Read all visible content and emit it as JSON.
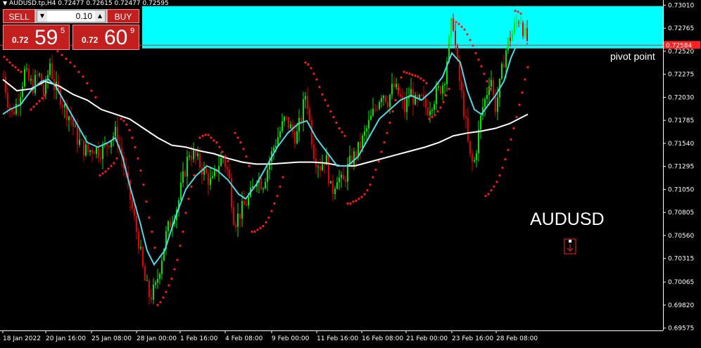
{
  "chart_title": "AUDUSD.tp,H4  0.72477 0.72615 0.72477 0.72595",
  "trade_panel": {
    "sell_label": "SELL",
    "buy_label": "BUY",
    "lot": "0.10",
    "sell_prefix": "0.72",
    "sell_big": "59",
    "sell_sup": "5",
    "buy_prefix": "0.72",
    "buy_big": "60",
    "buy_sup": "9"
  },
  "pivot_text": "pivot point",
  "symbol_text": "AUDUSD",
  "current_price_label": "0.72584",
  "colors": {
    "bull": "#00e600",
    "bear": "#e00000",
    "ma_fast": "#4fd8ea",
    "ma_slow": "#ffffff",
    "sar": "#ff1a1a",
    "zone": "#00ffff",
    "price_line": "#ff2020"
  },
  "chart_data": {
    "type": "candlestick",
    "title": "AUDUSD.tp,H4",
    "y_ticks": [
      "0.73010",
      "0.72765",
      "0.72520",
      "0.72275",
      "0.72030",
      "0.71785",
      "0.71540",
      "0.71295",
      "0.71050",
      "0.70805",
      "0.70560",
      "0.70315",
      "0.70065",
      "0.69820",
      "0.69575"
    ],
    "ylim": [
      0.6955,
      0.7305
    ],
    "x_ticks": [
      "18 Jan 2022",
      "20 Jan 16:00",
      "25 Jan 08:00",
      "28 Jan 00:00",
      "1 Feb 16:00",
      "4 Feb 08:00",
      "9 Feb 00:00",
      "11 Feb 16:00",
      "16 Feb 08:00",
      "21 Feb 00:00",
      "23 Feb 16:00",
      "28 Feb 08:00"
    ],
    "resistance_zone": [
      0.7255,
      0.73
    ],
    "pivot_level": 0.72584,
    "close_path": [
      [
        0,
        0.7225
      ],
      [
        6,
        0.72
      ],
      [
        12,
        0.7185
      ],
      [
        18,
        0.7195
      ],
      [
        24,
        0.721
      ],
      [
        30,
        0.723
      ],
      [
        36,
        0.722
      ],
      [
        42,
        0.7215
      ],
      [
        50,
        0.7228
      ],
      [
        58,
        0.7205
      ],
      [
        66,
        0.724
      ],
      [
        72,
        0.7215
      ],
      [
        80,
        0.7205
      ],
      [
        88,
        0.719
      ],
      [
        96,
        0.718
      ],
      [
        104,
        0.716
      ],
      [
        112,
        0.715
      ],
      [
        120,
        0.7145
      ],
      [
        128,
        0.715
      ],
      [
        136,
        0.7145
      ],
      [
        144,
        0.715
      ],
      [
        152,
        0.716
      ],
      [
        160,
        0.7165
      ],
      [
        168,
        0.714
      ],
      [
        176,
        0.711
      ],
      [
        184,
        0.708
      ],
      [
        192,
        0.705
      ],
      [
        200,
        0.701
      ],
      [
        208,
        0.699
      ],
      [
        216,
        0.7
      ],
      [
        224,
        0.703
      ],
      [
        232,
        0.706
      ],
      [
        240,
        0.7075
      ],
      [
        248,
        0.709
      ],
      [
        256,
        0.712
      ],
      [
        264,
        0.7145
      ],
      [
        272,
        0.714
      ],
      [
        280,
        0.713
      ],
      [
        288,
        0.712
      ],
      [
        296,
        0.711
      ],
      [
        304,
        0.713
      ],
      [
        312,
        0.714
      ],
      [
        320,
        0.712
      ],
      [
        328,
        0.707
      ],
      [
        336,
        0.708
      ],
      [
        344,
        0.709
      ],
      [
        352,
        0.71
      ],
      [
        360,
        0.712
      ],
      [
        368,
        0.711
      ],
      [
        376,
        0.713
      ],
      [
        384,
        0.715
      ],
      [
        392,
        0.7165
      ],
      [
        400,
        0.718
      ],
      [
        408,
        0.717
      ],
      [
        416,
        0.716
      ],
      [
        424,
        0.7185
      ],
      [
        430,
        0.721
      ],
      [
        436,
        0.717
      ],
      [
        442,
        0.714
      ],
      [
        450,
        0.713
      ],
      [
        458,
        0.714
      ],
      [
        466,
        0.71
      ],
      [
        474,
        0.712
      ],
      [
        482,
        0.711
      ],
      [
        490,
        0.713
      ],
      [
        498,
        0.714
      ],
      [
        506,
        0.715
      ],
      [
        514,
        0.7165
      ],
      [
        522,
        0.718
      ],
      [
        530,
        0.7195
      ],
      [
        538,
        0.721
      ],
      [
        546,
        0.72
      ],
      [
        554,
        0.7215
      ],
      [
        562,
        0.7205
      ],
      [
        570,
        0.719
      ],
      [
        578,
        0.721
      ],
      [
        586,
        0.7195
      ],
      [
        594,
        0.72
      ],
      [
        602,
        0.719
      ],
      [
        610,
        0.72
      ],
      [
        618,
        0.721
      ],
      [
        626,
        0.722
      ],
      [
        632,
        0.7255
      ],
      [
        638,
        0.729
      ],
      [
        644,
        0.724
      ],
      [
        650,
        0.721
      ],
      [
        656,
        0.718
      ],
      [
        662,
        0.714
      ],
      [
        668,
        0.713
      ],
      [
        674,
        0.716
      ],
      [
        680,
        0.719
      ],
      [
        686,
        0.7205
      ],
      [
        692,
        0.723
      ],
      [
        698,
        0.719
      ],
      [
        704,
        0.721
      ],
      [
        710,
        0.724
      ],
      [
        716,
        0.726
      ],
      [
        722,
        0.727
      ],
      [
        728,
        0.728
      ],
      [
        734,
        0.729
      ],
      [
        740,
        0.727
      ],
      [
        746,
        0.7259
      ]
    ],
    "series": [
      {
        "name": "",
        "type": "line",
        "points": [
          [
            0,
            0.7222
          ],
          [
            20,
            0.721
          ],
          [
            40,
            0.7212
          ],
          [
            60,
            0.722
          ],
          [
            80,
            0.7215
          ],
          [
            100,
            0.7206
          ],
          [
            120,
            0.72
          ],
          [
            140,
            0.719
          ],
          [
            160,
            0.7185
          ],
          [
            180,
            0.718
          ],
          [
            200,
            0.717
          ],
          [
            220,
            0.716
          ],
          [
            240,
            0.7152
          ],
          [
            260,
            0.715
          ],
          [
            280,
            0.7146
          ],
          [
            300,
            0.7143
          ],
          [
            320,
            0.7138
          ],
          [
            340,
            0.7134
          ],
          [
            360,
            0.7132
          ],
          [
            380,
            0.7132
          ],
          [
            400,
            0.7133
          ],
          [
            420,
            0.7134
          ],
          [
            440,
            0.7134
          ],
          [
            460,
            0.7133
          ],
          [
            480,
            0.713
          ],
          [
            500,
            0.713
          ],
          [
            520,
            0.7134
          ],
          [
            540,
            0.7138
          ],
          [
            560,
            0.7142
          ],
          [
            580,
            0.7146
          ],
          [
            600,
            0.715
          ],
          [
            620,
            0.7155
          ],
          [
            640,
            0.7162
          ],
          [
            660,
            0.7165
          ],
          [
            680,
            0.7167
          ],
          [
            700,
            0.717
          ],
          [
            720,
            0.7175
          ],
          [
            746,
            0.7185
          ]
        ]
      },
      {
        "name": "",
        "type": "line",
        "points": [
          [
            0,
            0.7185
          ],
          [
            10,
            0.719
          ],
          [
            25,
            0.7195
          ],
          [
            40,
            0.721
          ],
          [
            55,
            0.722
          ],
          [
            65,
            0.7222
          ],
          [
            75,
            0.7215
          ],
          [
            90,
            0.7195
          ],
          [
            105,
            0.7175
          ],
          [
            120,
            0.7155
          ],
          [
            135,
            0.715
          ],
          [
            150,
            0.7155
          ],
          [
            160,
            0.716
          ],
          [
            170,
            0.714
          ],
          [
            180,
            0.711
          ],
          [
            195,
            0.707
          ],
          [
            205,
            0.704
          ],
          [
            215,
            0.7025
          ],
          [
            230,
            0.704
          ],
          [
            245,
            0.7075
          ],
          [
            260,
            0.7105
          ],
          [
            275,
            0.712
          ],
          [
            290,
            0.713
          ],
          [
            305,
            0.7125
          ],
          [
            320,
            0.7115
          ],
          [
            335,
            0.71
          ],
          [
            345,
            0.7095
          ],
          [
            360,
            0.711
          ],
          [
            375,
            0.713
          ],
          [
            390,
            0.715
          ],
          [
            405,
            0.7165
          ],
          [
            420,
            0.7175
          ],
          [
            432,
            0.7178
          ],
          [
            445,
            0.716
          ],
          [
            460,
            0.7145
          ],
          [
            475,
            0.713
          ],
          [
            490,
            0.713
          ],
          [
            505,
            0.714
          ],
          [
            520,
            0.716
          ],
          [
            535,
            0.718
          ],
          [
            550,
            0.719
          ],
          [
            565,
            0.72
          ],
          [
            580,
            0.7205
          ],
          [
            595,
            0.72
          ],
          [
            610,
            0.721
          ],
          [
            625,
            0.7225
          ],
          [
            638,
            0.725
          ],
          [
            650,
            0.724
          ],
          [
            660,
            0.721
          ],
          [
            670,
            0.719
          ],
          [
            680,
            0.7185
          ],
          [
            690,
            0.7195
          ],
          [
            700,
            0.7205
          ],
          [
            712,
            0.722
          ],
          [
            722,
            0.7245
          ],
          [
            732,
            0.7262
          ],
          [
            740,
            0.7262
          ],
          [
            746,
            0.7262
          ]
        ]
      }
    ],
    "sar": [
      [
        2,
        0.7246
      ],
      [
        6,
        0.7243
      ],
      [
        10,
        0.724
      ],
      [
        14,
        0.7237
      ],
      [
        18,
        0.7235
      ],
      [
        22,
        0.7232
      ],
      [
        26,
        0.723
      ],
      [
        40,
        0.719
      ],
      [
        44,
        0.7193
      ],
      [
        48,
        0.7196
      ],
      [
        52,
        0.7199
      ],
      [
        56,
        0.7202
      ],
      [
        60,
        0.7205
      ],
      [
        70,
        0.7258
      ],
      [
        74,
        0.7255
      ],
      [
        78,
        0.7252
      ],
      [
        84,
        0.7248
      ],
      [
        90,
        0.7244
      ],
      [
        96,
        0.724
      ],
      [
        102,
        0.7236
      ],
      [
        108,
        0.723
      ],
      [
        114,
        0.7225
      ],
      [
        120,
        0.7218
      ],
      [
        126,
        0.721
      ],
      [
        132,
        0.7203
      ],
      [
        138,
        0.712
      ],
      [
        142,
        0.7122
      ],
      [
        146,
        0.7124
      ],
      [
        150,
        0.7127
      ],
      [
        154,
        0.713
      ],
      [
        158,
        0.7133
      ],
      [
        162,
        0.7138
      ],
      [
        168,
        0.718
      ],
      [
        172,
        0.7178
      ],
      [
        176,
        0.7174
      ],
      [
        180,
        0.7168
      ],
      [
        184,
        0.716
      ],
      [
        188,
        0.715
      ],
      [
        192,
        0.7138
      ],
      [
        196,
        0.7125
      ],
      [
        200,
        0.711
      ],
      [
        204,
        0.7092
      ],
      [
        208,
        0.7075
      ],
      [
        212,
        0.706
      ],
      [
        216,
        0.7043
      ],
      [
        220,
        0.6982
      ],
      [
        224,
        0.6985
      ],
      [
        228,
        0.699
      ],
      [
        232,
        0.6996
      ],
      [
        236,
        0.7003
      ],
      [
        240,
        0.701
      ],
      [
        244,
        0.702
      ],
      [
        248,
        0.703
      ],
      [
        252,
        0.7045
      ],
      [
        256,
        0.706
      ],
      [
        260,
        0.708
      ],
      [
        264,
        0.7095
      ],
      [
        268,
        0.7108
      ],
      [
        272,
        0.712
      ],
      [
        280,
        0.716
      ],
      [
        284,
        0.7162
      ],
      [
        288,
        0.7163
      ],
      [
        292,
        0.7163
      ],
      [
        296,
        0.716
      ],
      [
        300,
        0.7157
      ],
      [
        304,
        0.7155
      ],
      [
        308,
        0.715
      ],
      [
        312,
        0.7145
      ],
      [
        316,
        0.714
      ],
      [
        320,
        0.7135
      ],
      [
        330,
        0.7165
      ],
      [
        334,
        0.716
      ],
      [
        338,
        0.7155
      ],
      [
        342,
        0.7148
      ],
      [
        346,
        0.714
      ],
      [
        350,
        0.713
      ],
      [
        354,
        0.706
      ],
      [
        358,
        0.706
      ],
      [
        362,
        0.7062
      ],
      [
        366,
        0.7064
      ],
      [
        370,
        0.7066
      ],
      [
        374,
        0.707
      ],
      [
        378,
        0.7075
      ],
      [
        382,
        0.7082
      ],
      [
        386,
        0.709
      ],
      [
        390,
        0.7098
      ],
      [
        394,
        0.7108
      ],
      [
        398,
        0.7118
      ],
      [
        430,
        0.724
      ],
      [
        434,
        0.7238
      ],
      [
        438,
        0.7234
      ],
      [
        442,
        0.7228
      ],
      [
        446,
        0.7222
      ],
      [
        450,
        0.7214
      ],
      [
        454,
        0.7206
      ],
      [
        458,
        0.72
      ],
      [
        462,
        0.7194
      ],
      [
        466,
        0.7188
      ],
      [
        470,
        0.7182
      ],
      [
        474,
        0.7176
      ],
      [
        478,
        0.717
      ],
      [
        482,
        0.7166
      ],
      [
        486,
        0.7162
      ],
      [
        490,
        0.709
      ],
      [
        494,
        0.709
      ],
      [
        498,
        0.7092
      ],
      [
        502,
        0.7093
      ],
      [
        506,
        0.7095
      ],
      [
        510,
        0.7097
      ],
      [
        514,
        0.71
      ],
      [
        518,
        0.7104
      ],
      [
        522,
        0.711
      ],
      [
        526,
        0.7118
      ],
      [
        530,
        0.7126
      ],
      [
        534,
        0.7135
      ],
      [
        538,
        0.7145
      ],
      [
        542,
        0.7155
      ],
      [
        546,
        0.7165
      ],
      [
        550,
        0.7176
      ],
      [
        554,
        0.7188
      ],
      [
        558,
        0.72
      ],
      [
        562,
        0.7212
      ],
      [
        566,
        0.7224
      ],
      [
        570,
        0.723
      ],
      [
        574,
        0.7229
      ],
      [
        578,
        0.7228
      ],
      [
        582,
        0.7227
      ],
      [
        586,
        0.7226
      ],
      [
        590,
        0.7225
      ],
      [
        594,
        0.7223
      ],
      [
        598,
        0.7221
      ],
      [
        602,
        0.7218
      ],
      [
        606,
        0.718
      ],
      [
        610,
        0.7182
      ],
      [
        614,
        0.7184
      ],
      [
        618,
        0.7188
      ],
      [
        622,
        0.7192
      ],
      [
        626,
        0.7198
      ],
      [
        630,
        0.7205
      ],
      [
        634,
        0.7212
      ],
      [
        640,
        0.7285
      ],
      [
        644,
        0.7283
      ],
      [
        648,
        0.7281
      ],
      [
        652,
        0.7278
      ],
      [
        656,
        0.7275
      ],
      [
        660,
        0.727
      ],
      [
        664,
        0.7264
      ],
      [
        668,
        0.7258
      ],
      [
        672,
        0.725
      ],
      [
        676,
        0.7243
      ],
      [
        680,
        0.7236
      ],
      [
        684,
        0.7228
      ],
      [
        688,
        0.722
      ],
      [
        692,
        0.7212
      ],
      [
        686,
        0.7098
      ],
      [
        690,
        0.71
      ],
      [
        694,
        0.7104
      ],
      [
        698,
        0.7108
      ],
      [
        702,
        0.7113
      ],
      [
        706,
        0.712
      ],
      [
        710,
        0.7128
      ],
      [
        714,
        0.7137
      ],
      [
        718,
        0.7147
      ],
      [
        722,
        0.7158
      ],
      [
        726,
        0.717
      ],
      [
        730,
        0.7182
      ],
      [
        734,
        0.7195
      ],
      [
        738,
        0.7208
      ],
      [
        742,
        0.7222
      ],
      [
        746,
        0.7235
      ],
      [
        728,
        0.7295
      ],
      [
        732,
        0.7294
      ],
      [
        736,
        0.7292
      ]
    ]
  }
}
